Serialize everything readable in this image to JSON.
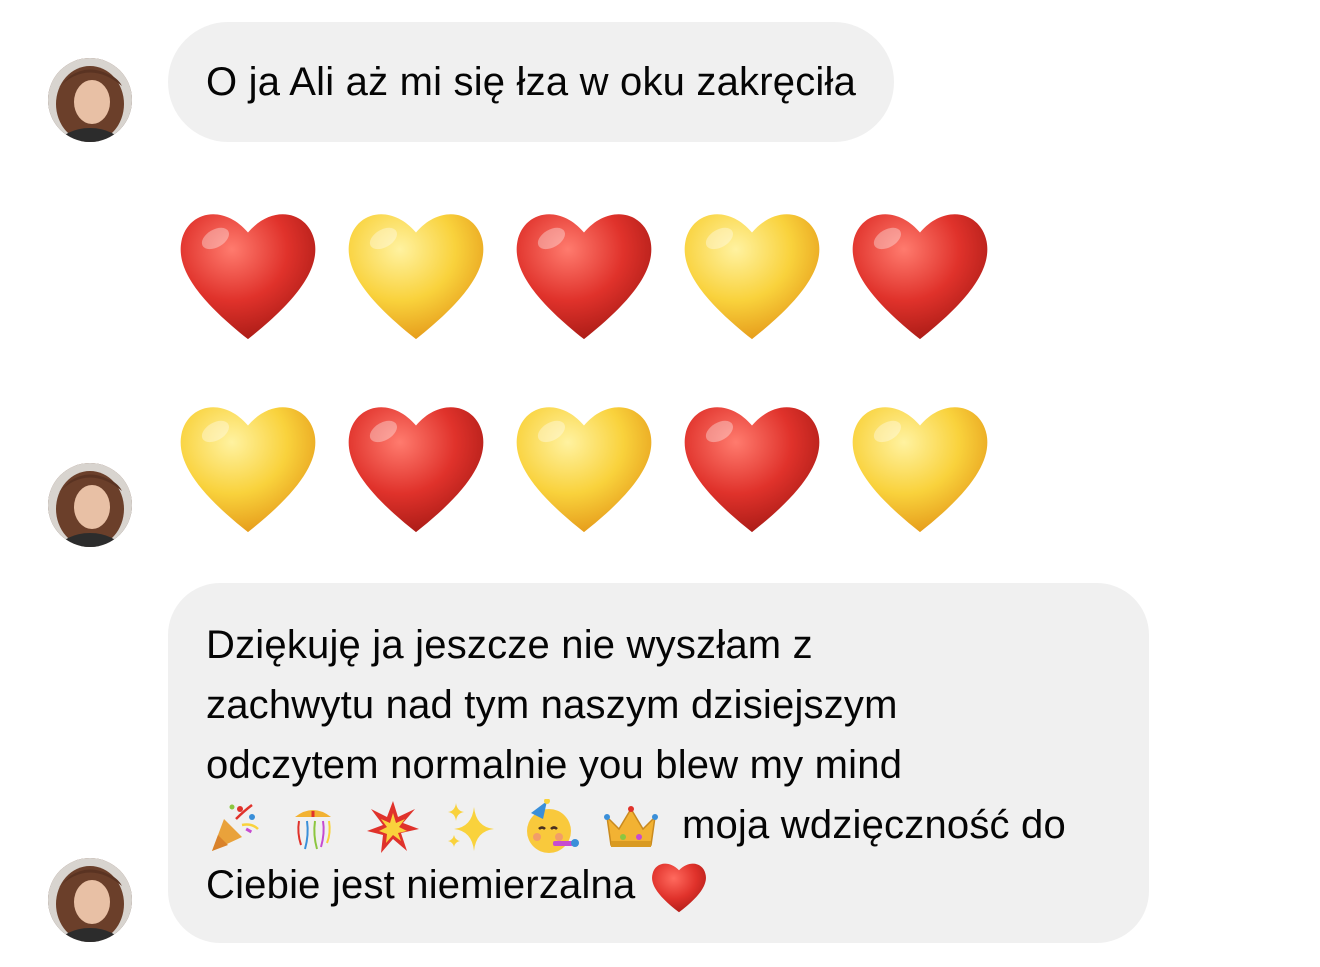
{
  "conversation": {
    "messages": [
      {
        "text": "O ja Ali aż mi się łza w oku zakręciła"
      },
      {
        "emoji_grid": {
          "row1": [
            "red",
            "yellow",
            "red",
            "yellow",
            "red"
          ],
          "row2": [
            "yellow",
            "red",
            "yellow",
            "red",
            "yellow"
          ]
        }
      },
      {
        "lines": [
          "Dziękuję ja jeszcze nie wyszłam z",
          "zachwytu nad tym naszym dzisiejszym",
          "odczytem normalnie you blew my mind"
        ],
        "emoji_line_text": "moja wdzięczność do",
        "emoji_sequence": [
          "party-popper-icon",
          "confetti-ball-icon",
          "collision-icon",
          "sparkles-icon",
          "partying-face-icon",
          "crown-icon"
        ],
        "last_line": "Ciebie jest niemierzalna",
        "trailing_emoji": "red-heart-icon"
      }
    ]
  },
  "colors": {
    "bubble_bg": "#f0f0f0",
    "text": "#050505",
    "heart_red": "#e0322b",
    "heart_yellow": "#f9d23c"
  }
}
